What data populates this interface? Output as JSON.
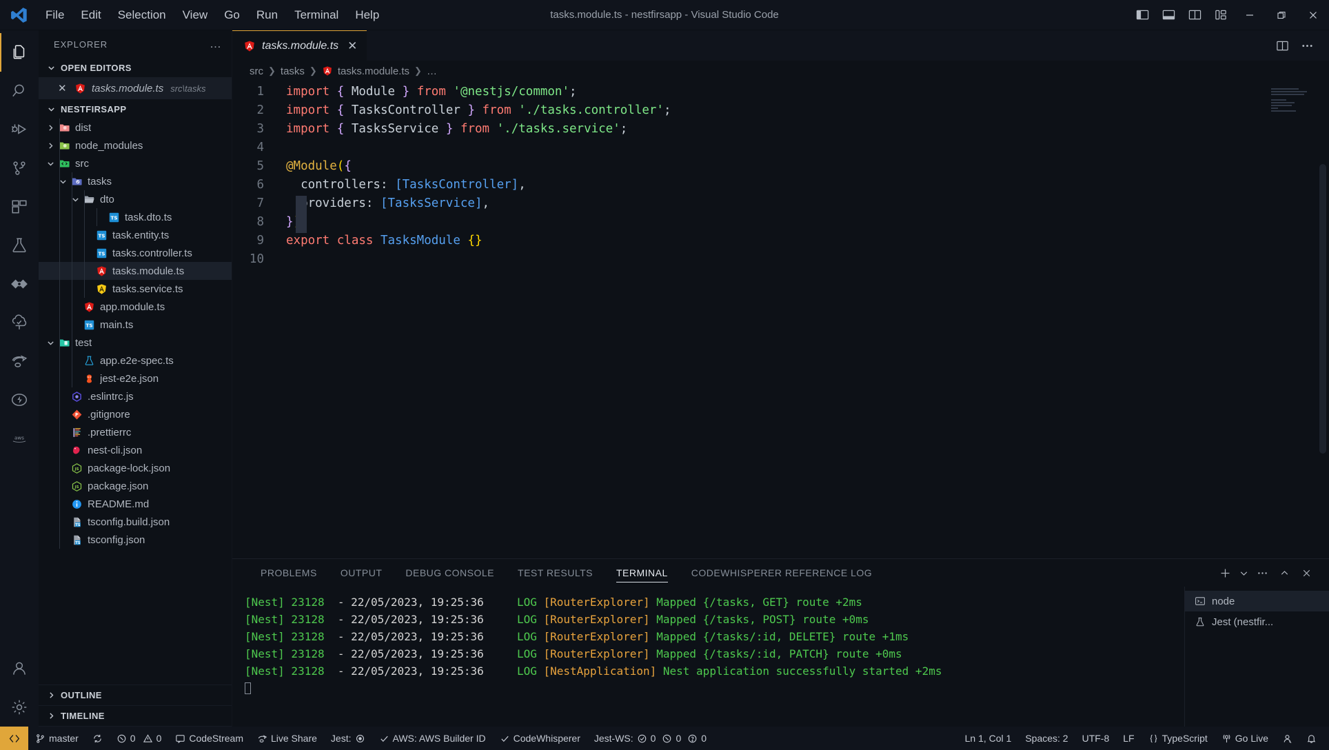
{
  "titlebar": {
    "logo_icon": "vscode-logo-icon",
    "menus": [
      "File",
      "Edit",
      "Selection",
      "View",
      "Go",
      "Run",
      "Terminal",
      "Help"
    ],
    "window_title": "tasks.module.ts - nestfirsapp - Visual Studio Code",
    "layout_buttons": [
      "toggle-primary-sidebar-icon",
      "toggle-panel-icon",
      "toggle-secondary-sidebar-icon",
      "customize-layout-icon"
    ],
    "window_controls": [
      "minimize-icon",
      "restore-icon",
      "close-icon"
    ]
  },
  "activitybar": {
    "items": [
      {
        "name": "explorer",
        "icon": "files-icon",
        "active": true
      },
      {
        "name": "search",
        "icon": "search-icon",
        "active": false
      },
      {
        "name": "run-and-debug",
        "icon": "debug-icon",
        "active": false
      },
      {
        "name": "source-control",
        "icon": "source-control-icon",
        "active": false
      },
      {
        "name": "extensions",
        "icon": "extensions-icon",
        "active": false
      },
      {
        "name": "testing",
        "icon": "beaker-icon",
        "active": false
      },
      {
        "name": "codewhisperer",
        "icon": "eye-diamond-icon",
        "active": false
      },
      {
        "name": "codestream",
        "icon": "cloud-check-icon",
        "active": false
      },
      {
        "name": "live-share",
        "icon": "live-share-icon",
        "active": false
      },
      {
        "name": "thunder-client",
        "icon": "lightning-icon",
        "active": false
      },
      {
        "name": "aws-toolkit",
        "icon": "aws-icon",
        "active": false
      }
    ],
    "bottom_items": [
      {
        "name": "accounts",
        "icon": "account-icon"
      },
      {
        "name": "settings",
        "icon": "gear-icon"
      }
    ]
  },
  "sidebar": {
    "title": "EXPLORER",
    "more_actions": "…",
    "open_editors": {
      "label": "OPEN EDITORS",
      "expanded": true,
      "items": [
        {
          "close": "✕",
          "icon": "angular-red-icon",
          "name": "tasks.module.ts",
          "path": "src\\tasks"
        }
      ]
    },
    "workspace": {
      "label": "NESTFIRSAPP",
      "expanded": true,
      "tree": [
        {
          "depth": 1,
          "twisty": "right",
          "icon": "folder-dist-icon",
          "label": "dist",
          "selected": false
        },
        {
          "depth": 1,
          "twisty": "right",
          "icon": "folder-node-modules-icon",
          "label": "node_modules",
          "selected": false
        },
        {
          "depth": 1,
          "twisty": "down",
          "icon": "folder-src-icon",
          "label": "src",
          "selected": false
        },
        {
          "depth": 2,
          "twisty": "down",
          "icon": "folder-tasks-icon",
          "label": "tasks",
          "selected": false
        },
        {
          "depth": 3,
          "twisty": "down",
          "icon": "folder-open-icon",
          "label": "dto",
          "selected": false
        },
        {
          "depth": 5,
          "twisty": "none",
          "icon": "typescript-icon",
          "label": "task.dto.ts",
          "selected": false
        },
        {
          "depth": 4,
          "twisty": "none",
          "icon": "typescript-icon",
          "label": "task.entity.ts",
          "selected": false
        },
        {
          "depth": 4,
          "twisty": "none",
          "icon": "typescript-icon",
          "label": "tasks.controller.ts",
          "selected": false
        },
        {
          "depth": 4,
          "twisty": "none",
          "icon": "angular-red-icon",
          "label": "tasks.module.ts",
          "selected": true
        },
        {
          "depth": 4,
          "twisty": "none",
          "icon": "angular-yellow-icon",
          "label": "tasks.service.ts",
          "selected": false
        },
        {
          "depth": 3,
          "twisty": "none",
          "icon": "angular-red-icon",
          "label": "app.module.ts",
          "selected": false
        },
        {
          "depth": 3,
          "twisty": "none",
          "icon": "typescript-icon",
          "label": "main.ts",
          "selected": false
        },
        {
          "depth": 1,
          "twisty": "down",
          "icon": "folder-test-icon",
          "label": "test",
          "selected": false
        },
        {
          "depth": 3,
          "twisty": "none",
          "icon": "beaker-file-icon",
          "label": "app.e2e-spec.ts",
          "selected": false
        },
        {
          "depth": 3,
          "twisty": "none",
          "icon": "jest-icon",
          "label": "jest-e2e.json",
          "selected": false
        },
        {
          "depth": 2,
          "twisty": "none",
          "icon": "eslint-icon",
          "label": ".eslintrc.js",
          "selected": false
        },
        {
          "depth": 2,
          "twisty": "none",
          "icon": "git-icon",
          "label": ".gitignore",
          "selected": false
        },
        {
          "depth": 2,
          "twisty": "none",
          "icon": "prettier-icon",
          "label": ".prettierrc",
          "selected": false
        },
        {
          "depth": 2,
          "twisty": "none",
          "icon": "nest-icon",
          "label": "nest-cli.json",
          "selected": false
        },
        {
          "depth": 2,
          "twisty": "none",
          "icon": "npm-icon",
          "label": "package-lock.json",
          "selected": false
        },
        {
          "depth": 2,
          "twisty": "none",
          "icon": "npm-icon",
          "label": "package.json",
          "selected": false
        },
        {
          "depth": 2,
          "twisty": "none",
          "icon": "info-icon",
          "label": "README.md",
          "selected": false
        },
        {
          "depth": 2,
          "twisty": "none",
          "icon": "tsconfig-icon",
          "label": "tsconfig.build.json",
          "selected": false
        },
        {
          "depth": 2,
          "twisty": "none",
          "icon": "tsconfig-icon",
          "label": "tsconfig.json",
          "selected": false
        }
      ]
    },
    "collapsed_sections": [
      {
        "label": "OUTLINE"
      },
      {
        "label": "TIMELINE"
      }
    ]
  },
  "editor": {
    "tab": {
      "icon": "angular-red-icon",
      "label": "tasks.module.ts",
      "close": "✕",
      "dirty": false
    },
    "tab_actions": [
      "split-editor-icon",
      "more-actions-icon"
    ],
    "breadcrumb": [
      "src",
      "tasks",
      "tasks.module.ts",
      "…"
    ],
    "line_numbers": [
      "1",
      "2",
      "3",
      "4",
      "5",
      "6",
      "7",
      "8",
      "9",
      "10"
    ],
    "code": [
      "import { Module } from '@nestjs/common';",
      "import { TasksController } from './tasks.controller';",
      "import { TasksService } from './tasks.service';",
      "",
      "@Module({",
      "  controllers: [TasksController],",
      "  providers: [TasksService],",
      "})",
      "export class TasksModule {}",
      ""
    ]
  },
  "panel": {
    "tabs": [
      "PROBLEMS",
      "OUTPUT",
      "DEBUG CONSOLE",
      "TEST RESULTS",
      "TERMINAL",
      "CODEWHISPERER REFERENCE LOG"
    ],
    "active_tab": "TERMINAL",
    "actions": [
      "new-terminal-icon",
      "terminal-dropdown-icon",
      "more-actions-icon",
      "maximize-panel-icon",
      "close-panel-icon"
    ],
    "terminal_lines": [
      {
        "prefix": "[Nest] 23128  - 22/05/2023, 19:25:36",
        "level": "LOG",
        "context": "[RouterExplorer]",
        "message": "Mapped {/tasks, GET} route +2ms"
      },
      {
        "prefix": "[Nest] 23128  - 22/05/2023, 19:25:36",
        "level": "LOG",
        "context": "[RouterExplorer]",
        "message": "Mapped {/tasks, POST} route +0ms"
      },
      {
        "prefix": "[Nest] 23128  - 22/05/2023, 19:25:36",
        "level": "LOG",
        "context": "[RouterExplorer]",
        "message": "Mapped {/tasks/:id, DELETE} route +1ms"
      },
      {
        "prefix": "[Nest] 23128  - 22/05/2023, 19:25:36",
        "level": "LOG",
        "context": "[RouterExplorer]",
        "message": "Mapped {/tasks/:id, PATCH} route +0ms"
      },
      {
        "prefix": "[Nest] 23128  - 22/05/2023, 19:25:36",
        "level": "LOG",
        "context": "[NestApplication]",
        "message": "Nest application successfully started +2ms"
      }
    ],
    "terminal_instances": [
      {
        "icon": "terminal-icon",
        "label": "node",
        "active": true
      },
      {
        "icon": "beaker-icon",
        "label": "Jest (nestfir...",
        "active": false
      }
    ]
  },
  "statusbar": {
    "remote_icon": "remote-window-icon",
    "left": [
      {
        "name": "branch",
        "icon": "git-branch-icon",
        "label": "master"
      },
      {
        "name": "sync",
        "icon": "sync-icon",
        "label": ""
      },
      {
        "name": "problems",
        "icon": "error-warning-icon",
        "label": "0  0"
      },
      {
        "name": "codestream",
        "icon": "codestream-icon",
        "label": "CodeStream"
      },
      {
        "name": "live-share",
        "icon": "live-share-icon",
        "label": "Live Share"
      },
      {
        "name": "jest",
        "icon": "jest-status-icon",
        "label": "Jest:"
      },
      {
        "name": "aws",
        "icon": "check-icon",
        "label": "AWS: AWS Builder ID"
      },
      {
        "name": "codewhisperer",
        "icon": "check-icon",
        "label": "CodeWhisperer"
      },
      {
        "name": "jest-ws",
        "icon": "jest-ws-icon",
        "label": "Jest-WS:  0  0  0"
      }
    ],
    "right": [
      {
        "name": "cursor-position",
        "label": "Ln 1, Col 1"
      },
      {
        "name": "indentation",
        "label": "Spaces: 2"
      },
      {
        "name": "encoding",
        "label": "UTF-8"
      },
      {
        "name": "eol",
        "label": "LF"
      },
      {
        "name": "language-mode",
        "label": "TypeScript",
        "icon": "braces-icon"
      },
      {
        "name": "go-live",
        "label": "Go Live",
        "icon": "broadcast-icon"
      },
      {
        "name": "accounts",
        "label": "",
        "icon": "account-icon"
      },
      {
        "name": "notifications",
        "label": "",
        "icon": "bell-icon"
      }
    ]
  },
  "colors": {
    "accent": "#e0a63a",
    "background": "#0d1117",
    "titlebar": "#10141c",
    "selection": "#1b212b",
    "keyword": "#ff7b72",
    "string": "#7ee787",
    "type": "#56a0f0",
    "function": "#e3b341",
    "terminal_green": "#4ec94e",
    "terminal_orange": "#e8a33d"
  }
}
